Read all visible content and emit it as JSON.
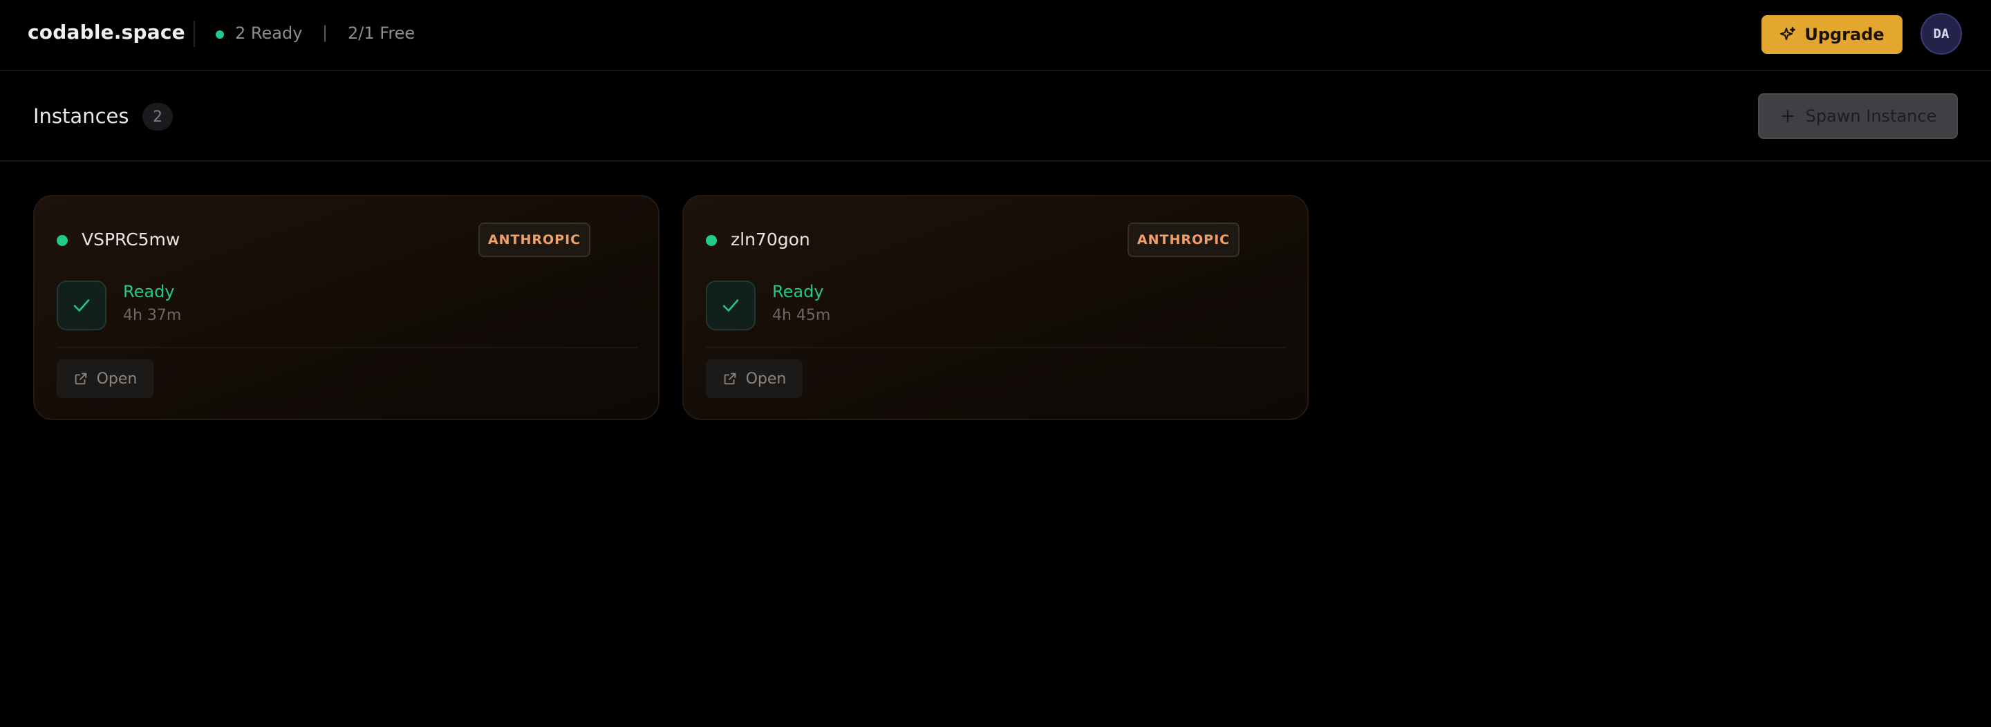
{
  "header": {
    "brand": "codable.space",
    "status_ready": "2 Ready",
    "separator": "|",
    "status_free": "2/1 Free",
    "upgrade_label": "Upgrade",
    "avatar_initials": "DA",
    "accent_color": "#e3a62f"
  },
  "page": {
    "title": "Instances",
    "count": "2",
    "spawn_label": "Spawn Instance"
  },
  "instances": [
    {
      "name": "VSPRC5mw",
      "provider": "ANTHROPIC",
      "state": "Ready",
      "uptime": "4h 37m",
      "open_label": "Open"
    },
    {
      "name": "zln70gon",
      "provider": "ANTHROPIC",
      "state": "Ready",
      "uptime": "4h 45m",
      "open_label": "Open"
    }
  ],
  "icons": {
    "status": "status-dot",
    "upgrade": "sparkles-icon",
    "spawn": "plus-icon",
    "ready": "check-icon",
    "open": "external-link-icon"
  },
  "colors": {
    "ready_green": "#22c98a",
    "provider_orange": "#f0a068"
  }
}
